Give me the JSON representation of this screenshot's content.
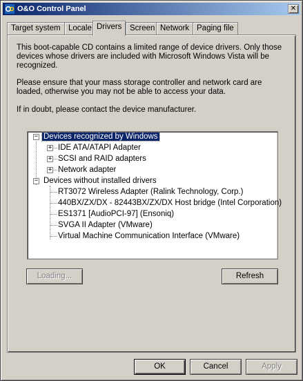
{
  "window": {
    "title": "O&O Control Panel",
    "close_glyph": "✕"
  },
  "tabs": [
    {
      "label": "Target system",
      "active": false
    },
    {
      "label": "Locale",
      "active": false
    },
    {
      "label": "Drivers",
      "active": true
    },
    {
      "label": "Screen",
      "active": false
    },
    {
      "label": "Network",
      "active": false
    },
    {
      "label": "Paging file",
      "active": false
    }
  ],
  "drivers": {
    "intro": "This boot-capable CD contains a limited range of device drivers. Only those devices whose drivers are included with Microsoft Windows Vista will be recognized.",
    "warning": "Please ensure that your mass storage controller and network card are loaded, otherwise you may not be able to access your data.",
    "contact": "If in doubt, please contact the device manufacturer.",
    "tree": {
      "recognized": {
        "label": "Devices recognized by Windows",
        "expander": "−",
        "selected": true,
        "children": [
          {
            "label": "IDE ATA/ATAPI Adapter",
            "expander": "+"
          },
          {
            "label": "SCSI and RAID adapters",
            "expander": "+"
          },
          {
            "label": "Network adapter",
            "expander": "+"
          }
        ]
      },
      "uninstalled": {
        "label": "Devices without installed drivers",
        "expander": "−",
        "children": [
          {
            "label": "RT3072 Wireless Adapter (Ralink Technology, Corp.)"
          },
          {
            "label": "440BX/ZX/DX - 82443BX/ZX/DX Host bridge (Intel Corporation)"
          },
          {
            "label": "ES1371 [AudioPCI-97] (Ensoniq)"
          },
          {
            "label": "SVGA II Adapter (VMware)"
          },
          {
            "label": "Virtual Machine Communication Interface (VMware)"
          }
        ]
      }
    },
    "loading_label": "Loading...",
    "refresh_label": "Refresh"
  },
  "footer": {
    "ok_label": "OK",
    "cancel_label": "Cancel",
    "apply_label": "Apply"
  },
  "colors": {
    "face": "#d4d0c8",
    "title_start": "#0a246a",
    "title_end": "#a6caf0",
    "selection": "#0a246a"
  }
}
